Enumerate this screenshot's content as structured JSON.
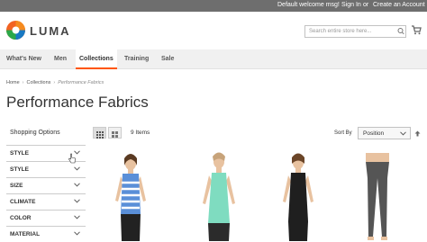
{
  "topbar": {
    "welcome": "Default welcome msg!",
    "signin": "Sign In",
    "or": "or",
    "create": "Create an Account"
  },
  "header": {
    "logo_text": "LUMA",
    "search_placeholder": "Search entire store here..."
  },
  "nav": {
    "items": [
      "What's New",
      "Men",
      "Collections",
      "Training",
      "Sale"
    ],
    "active": "Collections"
  },
  "breadcrumb": {
    "home": "Home",
    "collections": "Collections",
    "current": "Performance Fabrics"
  },
  "page_title": "Performance Fabrics",
  "sidebar": {
    "heading": "Shopping Options",
    "filters": [
      "STYLE",
      "STYLE",
      "SIZE",
      "CLIMATE",
      "COLOR",
      "MATERIAL"
    ]
  },
  "toolbar": {
    "count": "9 Items",
    "sort_label": "Sort By",
    "sort_value": "Position"
  },
  "colors": {
    "accent": "#ff5501",
    "topbar": "#6e6e6e",
    "nav_bg": "#f0f0f0"
  },
  "products": [
    {
      "top_color": "#5a8fd8",
      "bottom_color": "#222222"
    },
    {
      "top_color": "#7fdcc0",
      "bottom_color": "#2b2b2b"
    },
    {
      "top_color": "#1f1f1f",
      "bottom_color": "#1f1f1f"
    },
    {
      "top_color": "#555555",
      "bottom_color": "#555555"
    }
  ]
}
